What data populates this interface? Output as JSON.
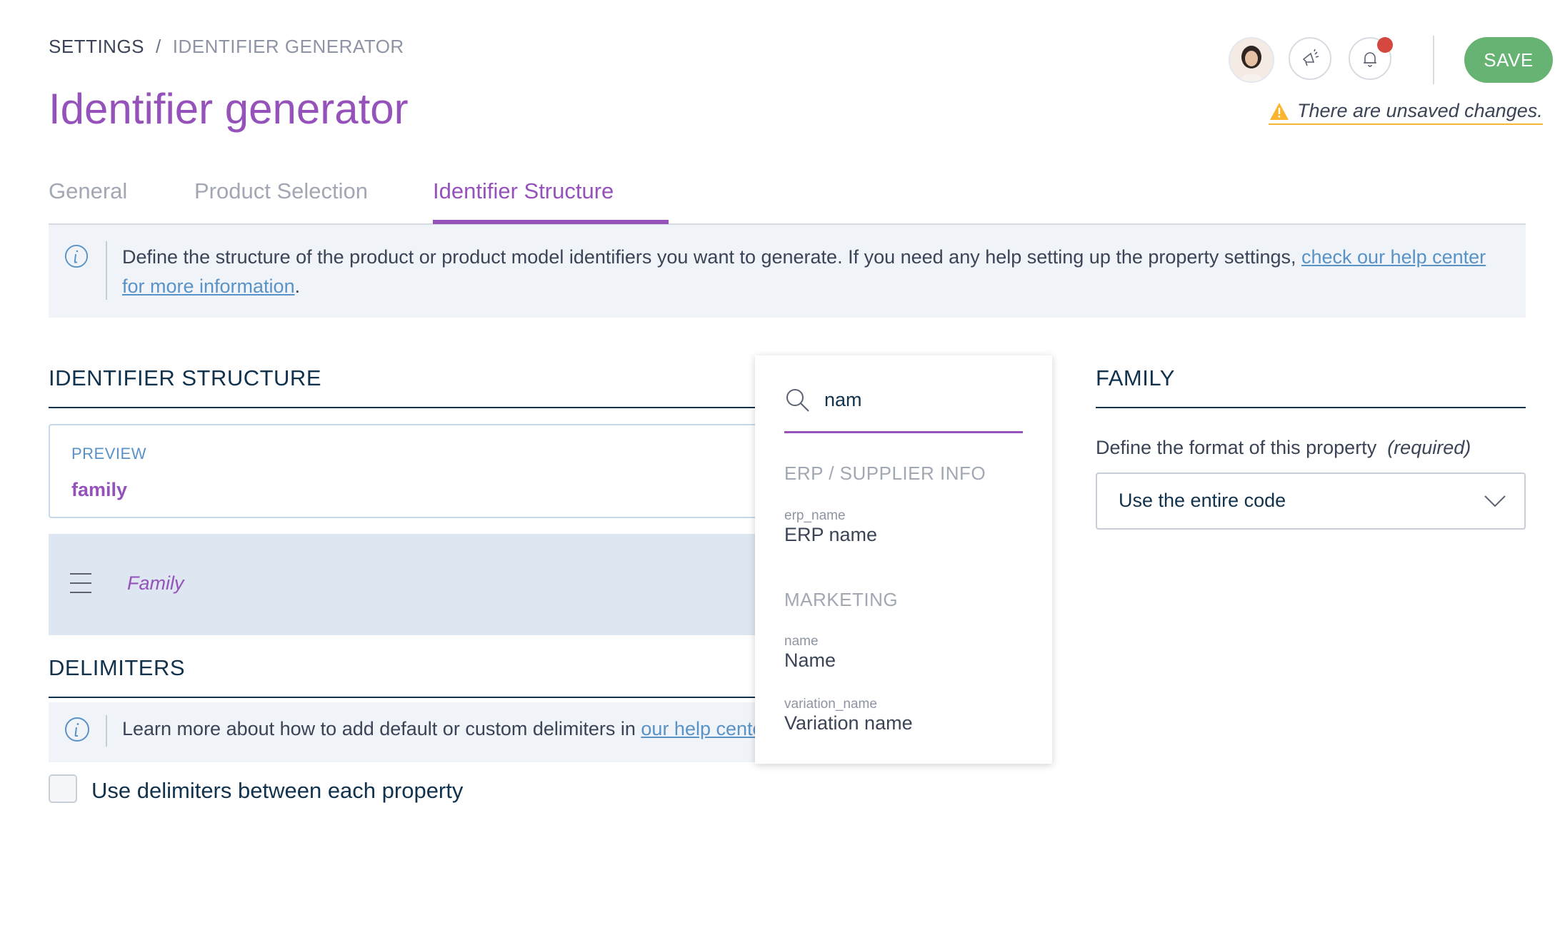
{
  "breadcrumb": {
    "root": "SETTINGS",
    "separator": "/",
    "current": "IDENTIFIER GENERATOR"
  },
  "title": "Identifier generator",
  "header": {
    "save_label": "SAVE",
    "unsaved_text": "There are unsaved changes."
  },
  "tabs": [
    {
      "label": "General",
      "active": false
    },
    {
      "label": "Product Selection",
      "active": false
    },
    {
      "label": "Identifier Structure",
      "active": true
    }
  ],
  "info": {
    "text": "Define the structure of the product or product model identifiers you want to generate. If you need any help setting up the property settings,",
    "link": "check our help center for more information"
  },
  "structure": {
    "title": "IDENTIFIER STRUCTURE",
    "preview_label": "PREVIEW",
    "preview_value": "family",
    "rows": [
      {
        "label": "Family"
      }
    ]
  },
  "delimiters": {
    "title": "DELIMITERS",
    "info_text": "Learn more about how to add default or custom delimiters in",
    "info_link": "our help center",
    "checkbox_label": "Use delimiters between each property",
    "checked": false
  },
  "dropdown": {
    "search_value": "nam",
    "groups": [
      {
        "label": "ERP / SUPPLIER INFO",
        "items": [
          {
            "code": "erp_name",
            "label": "ERP name"
          }
        ]
      },
      {
        "label": "MARKETING",
        "items": [
          {
            "code": "name",
            "label": "Name"
          },
          {
            "code": "variation_name",
            "label": "Variation name"
          }
        ]
      }
    ]
  },
  "family_panel": {
    "title": "FAMILY",
    "format_label": "Define the format of this property",
    "required_label": "(required)",
    "format_value": "Use the entire code"
  },
  "colors": {
    "accent": "#9452ba",
    "save": "#67b373",
    "link": "#5992c7",
    "warning": "#f9b52f",
    "notification": "#d4483f"
  },
  "icons": [
    "user-avatar",
    "megaphone-icon",
    "bell-icon",
    "warning-icon",
    "info-icon",
    "search-icon",
    "drag-handle-icon",
    "chevron-down-icon"
  ]
}
